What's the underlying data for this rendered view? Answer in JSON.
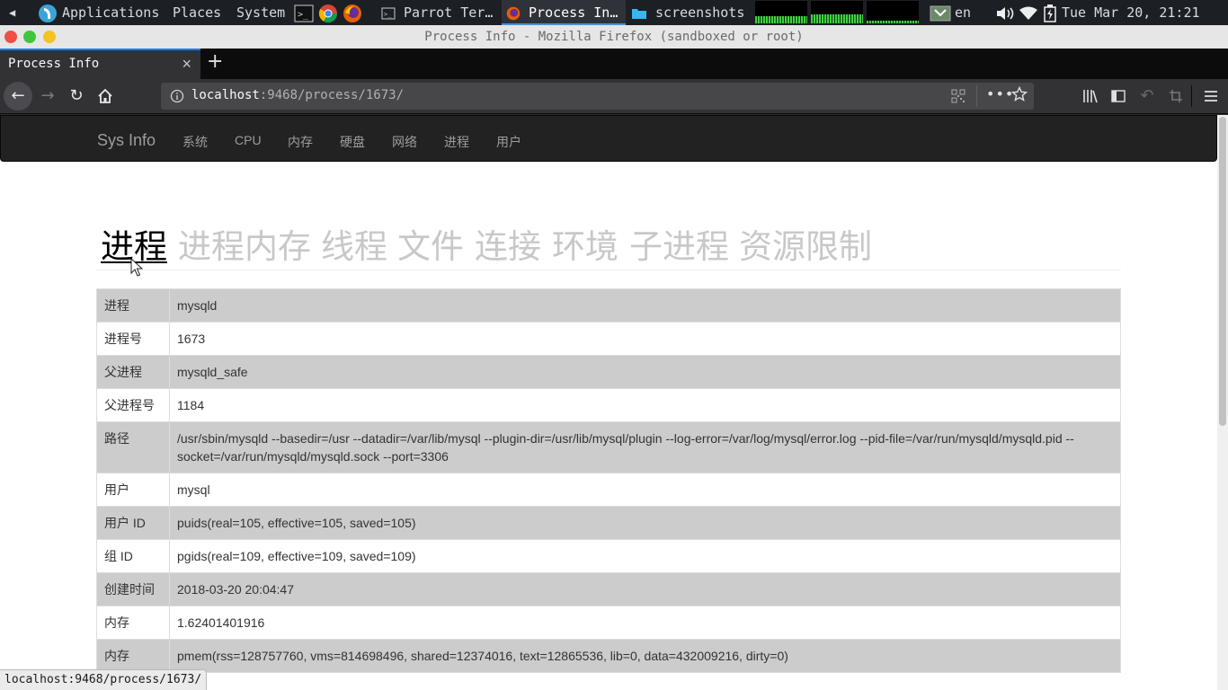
{
  "os_panel": {
    "menus": [
      "Applications",
      "Places",
      "System"
    ],
    "tasks": [
      {
        "label": "Parrot Ter…"
      },
      {
        "label": "Process In…",
        "active": true
      },
      {
        "label": "screenshots"
      }
    ],
    "keyboard_layout": "en",
    "clock": "Tue Mar 20, 21:21"
  },
  "browser": {
    "window_title": "Process Info - Mozilla Firefox (sandboxed or root)",
    "tab_label": "Process Info",
    "url_host": "localhost",
    "url_rest": ":9468/process/1673/",
    "status_url": "localhost:9468/process/1673/"
  },
  "site_nav": {
    "brand": "Sys Info",
    "items": [
      "系统",
      "CPU",
      "内存",
      "硬盘",
      "网络",
      "进程",
      "用户"
    ]
  },
  "sub_tabs": [
    "进程",
    "进程内存",
    "线程",
    "文件",
    "连接",
    "环境",
    "子进程",
    "资源限制"
  ],
  "active_sub_tab": "进程",
  "info_rows": [
    {
      "key": "进程",
      "value": "mysqld"
    },
    {
      "key": "进程号",
      "value": "1673"
    },
    {
      "key": "父进程",
      "value": "mysqld_safe"
    },
    {
      "key": "父进程号",
      "value": "1184"
    },
    {
      "key": "路径",
      "value": "/usr/sbin/mysqld --basedir=/usr --datadir=/var/lib/mysql --plugin-dir=/usr/lib/mysql/plugin --log-error=/var/log/mysql/error.log --pid-file=/var/run/mysqld/mysqld.pid --socket=/var/run/mysqld/mysqld.sock --port=3306"
    },
    {
      "key": "用户",
      "value": "mysql"
    },
    {
      "key": "用户 ID",
      "value": "puids(real=105, effective=105, saved=105)"
    },
    {
      "key": "组 ID",
      "value": "pgids(real=109, effective=109, saved=109)"
    },
    {
      "key": "创建时间",
      "value": "2018-03-20 20:04:47"
    },
    {
      "key": "内存",
      "value": "1.62401401916"
    },
    {
      "key": "内存",
      "value": "pmem(rss=128757760, vms=814698496, shared=12374016, text=12865536, lib=0, data=432009216, dirty=0)"
    }
  ],
  "colors": {
    "navbar_bg": "#222222",
    "row_shaded": "#cccccc",
    "firefox_accent": "#0a84ff"
  }
}
